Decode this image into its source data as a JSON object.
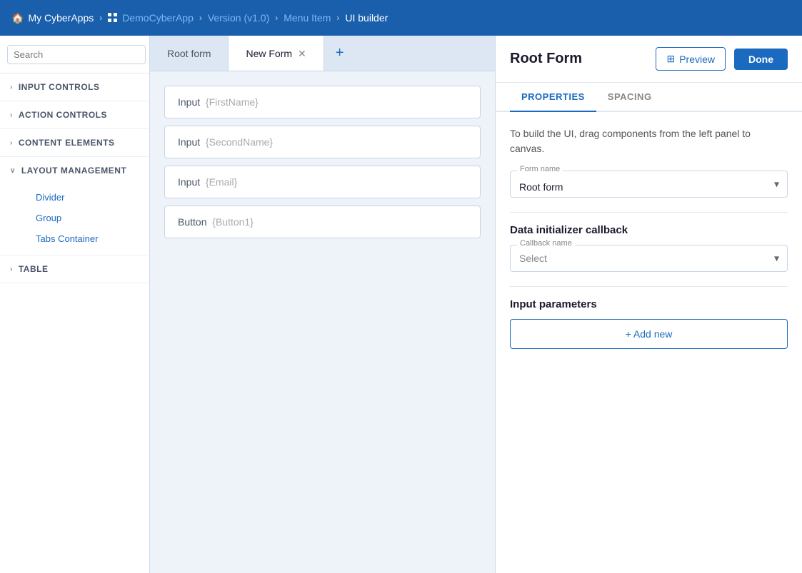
{
  "topbar": {
    "home_label": "My CyberApps",
    "app_label": "DemoCyberApp",
    "version_label": "Version (v1.0)",
    "menu_label": "Menu Item",
    "page_label": "UI builder"
  },
  "sidebar": {
    "search_placeholder": "Search",
    "sections": [
      {
        "id": "input-controls",
        "label": "INPUT CONTROLS",
        "expanded": false,
        "items": []
      },
      {
        "id": "action-controls",
        "label": "ACTION CONTROLS",
        "expanded": false,
        "items": []
      },
      {
        "id": "content-elements",
        "label": "CONTENT ELEMENTS",
        "expanded": false,
        "items": []
      },
      {
        "id": "layout-management",
        "label": "LAYOUT MANAGEMENT",
        "expanded": true,
        "items": [
          "Divider",
          "Group",
          "Tabs Container"
        ]
      },
      {
        "id": "table",
        "label": "TABLE",
        "expanded": false,
        "items": []
      }
    ]
  },
  "tabs": [
    {
      "id": "root-form",
      "label": "Root form",
      "active": false,
      "closeable": false
    },
    {
      "id": "new-form",
      "label": "New Form",
      "active": true,
      "closeable": true
    }
  ],
  "canvas": {
    "elements": [
      {
        "type": "Input",
        "placeholder": "{FirstName}"
      },
      {
        "type": "Input",
        "placeholder": "{SecondName}"
      },
      {
        "type": "Input",
        "placeholder": "{Email}"
      },
      {
        "type": "Button",
        "placeholder": "{Button1}"
      }
    ]
  },
  "right_panel": {
    "title": "Root Form",
    "preview_label": "Preview",
    "done_label": "Done",
    "tabs": [
      {
        "id": "properties",
        "label": "PROPERTIES",
        "active": true
      },
      {
        "id": "spacing",
        "label": "SPACING",
        "active": false
      }
    ],
    "hint_text": "To build the UI, drag components from the left panel to canvas.",
    "form_name_label": "Form name",
    "form_name_value": "Root form",
    "data_initializer_label": "Data initializer callback",
    "callback_label": "Callback name",
    "callback_placeholder": "Select",
    "input_params_label": "Input parameters",
    "add_new_label": "+ Add new"
  }
}
